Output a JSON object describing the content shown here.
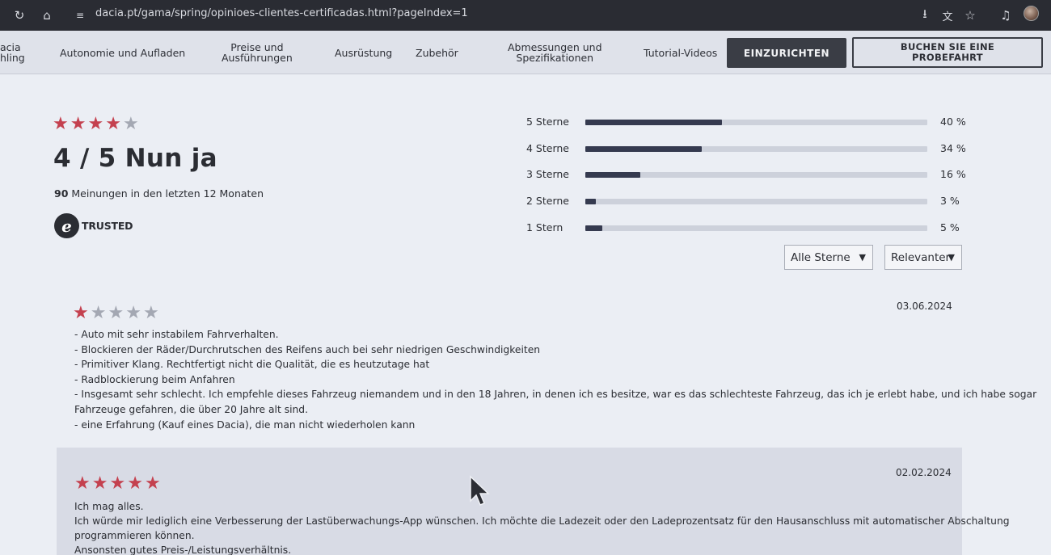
{
  "browser": {
    "url": "dacia.pt/gama/spring/opinioes-clientes-certificadas.html?pageIndex=1",
    "icons": [
      "reload-icon",
      "home-icon",
      "site-settings-icon",
      "install-app-icon",
      "translate-icon",
      "bookmark-star-icon",
      "media-control-icon",
      "profile-avatar"
    ]
  },
  "nav": {
    "partial_item_line1": "acia",
    "partial_item_line2": "hling",
    "items": [
      {
        "line1": "Autonomie und Aufladen",
        "line2": ""
      },
      {
        "line1": "Preise und",
        "line2": "Ausführungen"
      },
      {
        "line1": "Ausrüstung",
        "line2": ""
      },
      {
        "line1": "Zubehör",
        "line2": ""
      },
      {
        "line1": "Abmessungen und",
        "line2": "Spezifikationen"
      },
      {
        "line1": "Tutorial-Videos",
        "line2": ""
      }
    ],
    "configure_label": "EINZURICHTEN",
    "test_drive_line1": "BUCHEN SIE EINE",
    "test_drive_line2": "PROBEFAHRT"
  },
  "summary": {
    "rating": 4,
    "max_rating": 5,
    "score_text": "4 / 5 Nun ja",
    "count": "90",
    "count_text": "Meinungen in den letzten 12 Monaten",
    "trusted_mark": "e",
    "trusted_text": "TRUSTED"
  },
  "distribution": [
    {
      "label": "5 Sterne",
      "percent": 40,
      "percent_text": "40 %"
    },
    {
      "label": "4 Sterne",
      "percent": 34,
      "percent_text": "34 %"
    },
    {
      "label": "3 Sterne",
      "percent": 16,
      "percent_text": "16 %"
    },
    {
      "label": "2 Sterne",
      "percent": 3,
      "percent_text": "3 %"
    },
    {
      "label": "1 Stern",
      "percent": 5,
      "percent_text": "5 %"
    }
  ],
  "filters": {
    "stars_selected": "Alle Sterne",
    "sort_selected": "Relevanter"
  },
  "colors": {
    "star_on": "#c4414f",
    "star_off": "#a4a8b3",
    "bar_fill": "#353a4f",
    "nav_button_dark": "#3a3d45"
  },
  "reviews": [
    {
      "rating": 1,
      "date": "03.06.2024",
      "lines": [
        "- Auto mit sehr instabilem Fahrverhalten.",
        "- Blockieren der Räder/Durchrutschen des Reifens auch bei sehr niedrigen Geschwindigkeiten",
        "- Primitiver Klang. Rechtfertigt nicht die Qualität, die es heutzutage hat",
        "- Radblockierung beim Anfahren",
        "- Insgesamt sehr schlecht. Ich empfehle dieses Fahrzeug niemandem und in den 18 Jahren, in denen ich es besitze, war es das schlechteste Fahrzeug, das ich je erlebt habe, und ich habe sogar",
        "Fahrzeuge gefahren, die über 20 Jahre alt sind.",
        "- eine Erfahrung (Kauf eines Dacia), die man nicht wiederholen kann"
      ]
    },
    {
      "rating": 5,
      "date": "02.02.2024",
      "lines": [
        "Ich mag alles.",
        "Ich würde mir lediglich eine Verbesserung der Lastüberwachungs-App wünschen. Ich möchte die Ladezeit oder den Ladeprozentsatz für den Hausanschluss mit automatischer Abschaltung",
        "programmieren können.",
        "Ansonsten gutes Preis-/Leistungsverhältnis."
      ]
    }
  ]
}
